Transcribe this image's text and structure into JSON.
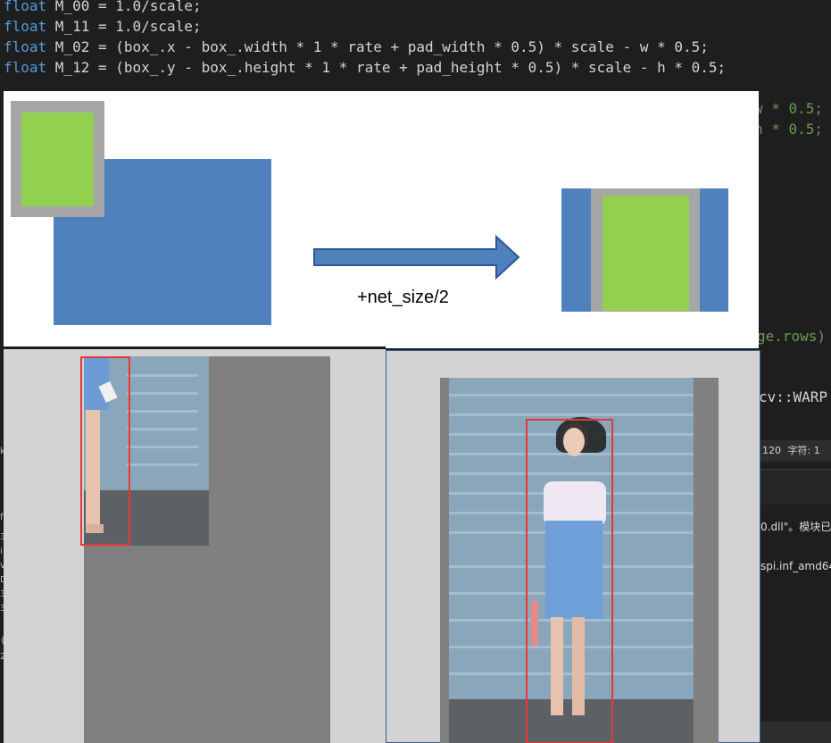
{
  "editor": {
    "lines": [
      {
        "kw": "float",
        "rest": " M_00 = 1.0/scale;"
      },
      {
        "kw": "float",
        "rest": " M_11 = 1.0/scale;"
      },
      {
        "kw": "float",
        "rest": " M_02 = (box_.x - box_.width * 1 * rate + pad_width * 0.5) * scale - w * 0.5;"
      },
      {
        "kw": "float",
        "rest": " M_12 = (box_.y - box_.height * 1 * rate + pad_height * 0.5) * scale - h * 0.5;"
      }
    ],
    "fragments": {
      "w_half": "w * 0.5;",
      "h_half": "h * 0.5;",
      "image_rows": "ge.rows)",
      "warp": "cv::WARP"
    },
    "status": {
      "col": "120",
      "char": "字符: 1"
    },
    "output": {
      "line1": "0.dll\"。模块已",
      "line2": "spi.inf_amd64"
    }
  },
  "diagram": {
    "arrow_label": "+net_size/2",
    "colors": {
      "blue": "#4f81bd",
      "gray": "#a6a6a6",
      "green": "#92d050"
    }
  },
  "images": {
    "bbox_color": "#e53935"
  }
}
